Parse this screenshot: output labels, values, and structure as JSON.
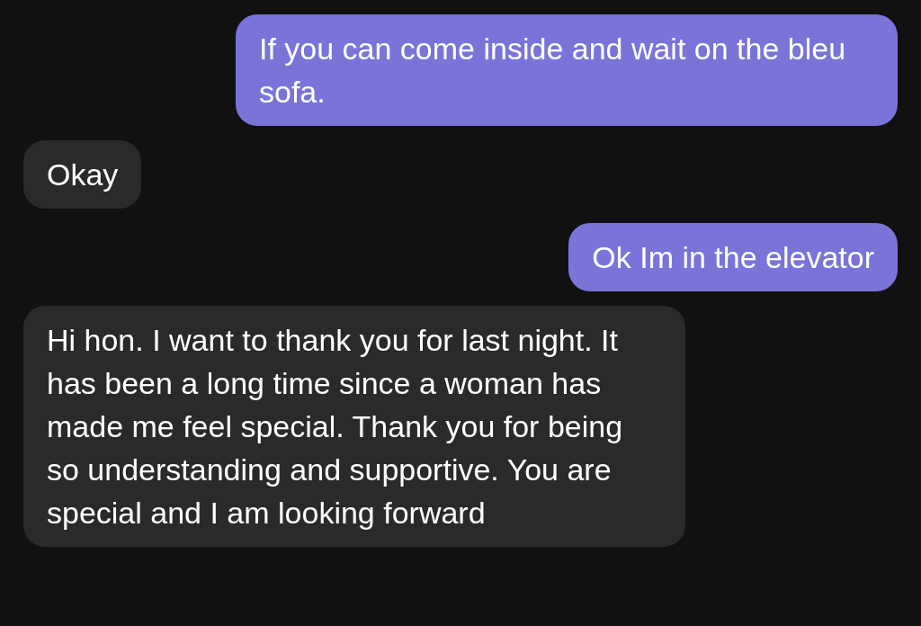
{
  "messages": [
    {
      "kind": "sent",
      "text": "If you can come inside and wait on the bleu sofa."
    },
    {
      "kind": "received",
      "text": "Okay"
    },
    {
      "kind": "sent",
      "text": "Ok Im in the elevator"
    },
    {
      "kind": "received",
      "text": "Hi hon. I want to thank you for last night. It has been a long time since a woman has made me feel special. Thank you for being so understanding and supportive. You are special and I am looking forward"
    }
  ]
}
